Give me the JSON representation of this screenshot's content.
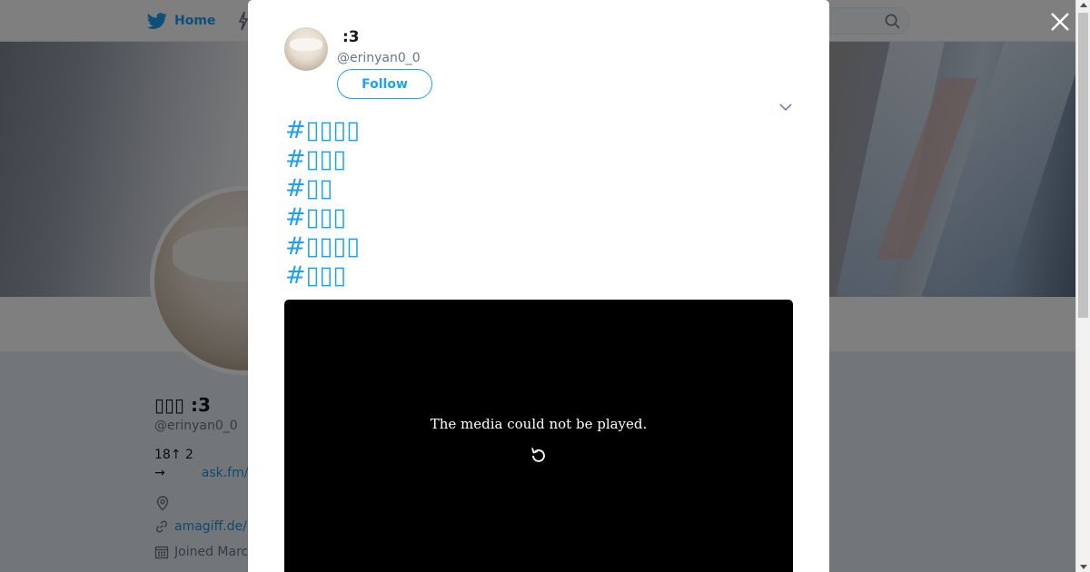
{
  "topbar": {
    "home_label": "Home",
    "search_placeholder": ""
  },
  "profile": {
    "display_name": "▯▯▯ :3",
    "handle": "@erinyan0_0",
    "bio_line1": "18↑ 2",
    "bio_line2_prefix": "→",
    "bio_link": "ask.fm/",
    "location": "",
    "website": "amagiff.de/",
    "joined": "Joined Marc"
  },
  "tweet": {
    "author_name": ":3",
    "author_handle": "@erinyan0_0",
    "follow_label": "Follow",
    "hashtags": [
      "#▯▯▯▯",
      "#▯▯▯",
      "#▯▯",
      "#▯▯▯",
      "#▯▯▯▯",
      "#▯▯▯"
    ],
    "media_error": "The media could not be played."
  },
  "colors": {
    "accent": "#1da1f2",
    "link": "#1b95e0",
    "muted": "#657786"
  },
  "icons": {
    "twitter": "twitter-bird-icon",
    "search": "search-icon",
    "close": "close-icon",
    "caret": "chevron-down-icon",
    "retry": "reload-icon",
    "location": "location-pin-icon",
    "link": "link-icon",
    "calendar": "calendar-icon"
  }
}
